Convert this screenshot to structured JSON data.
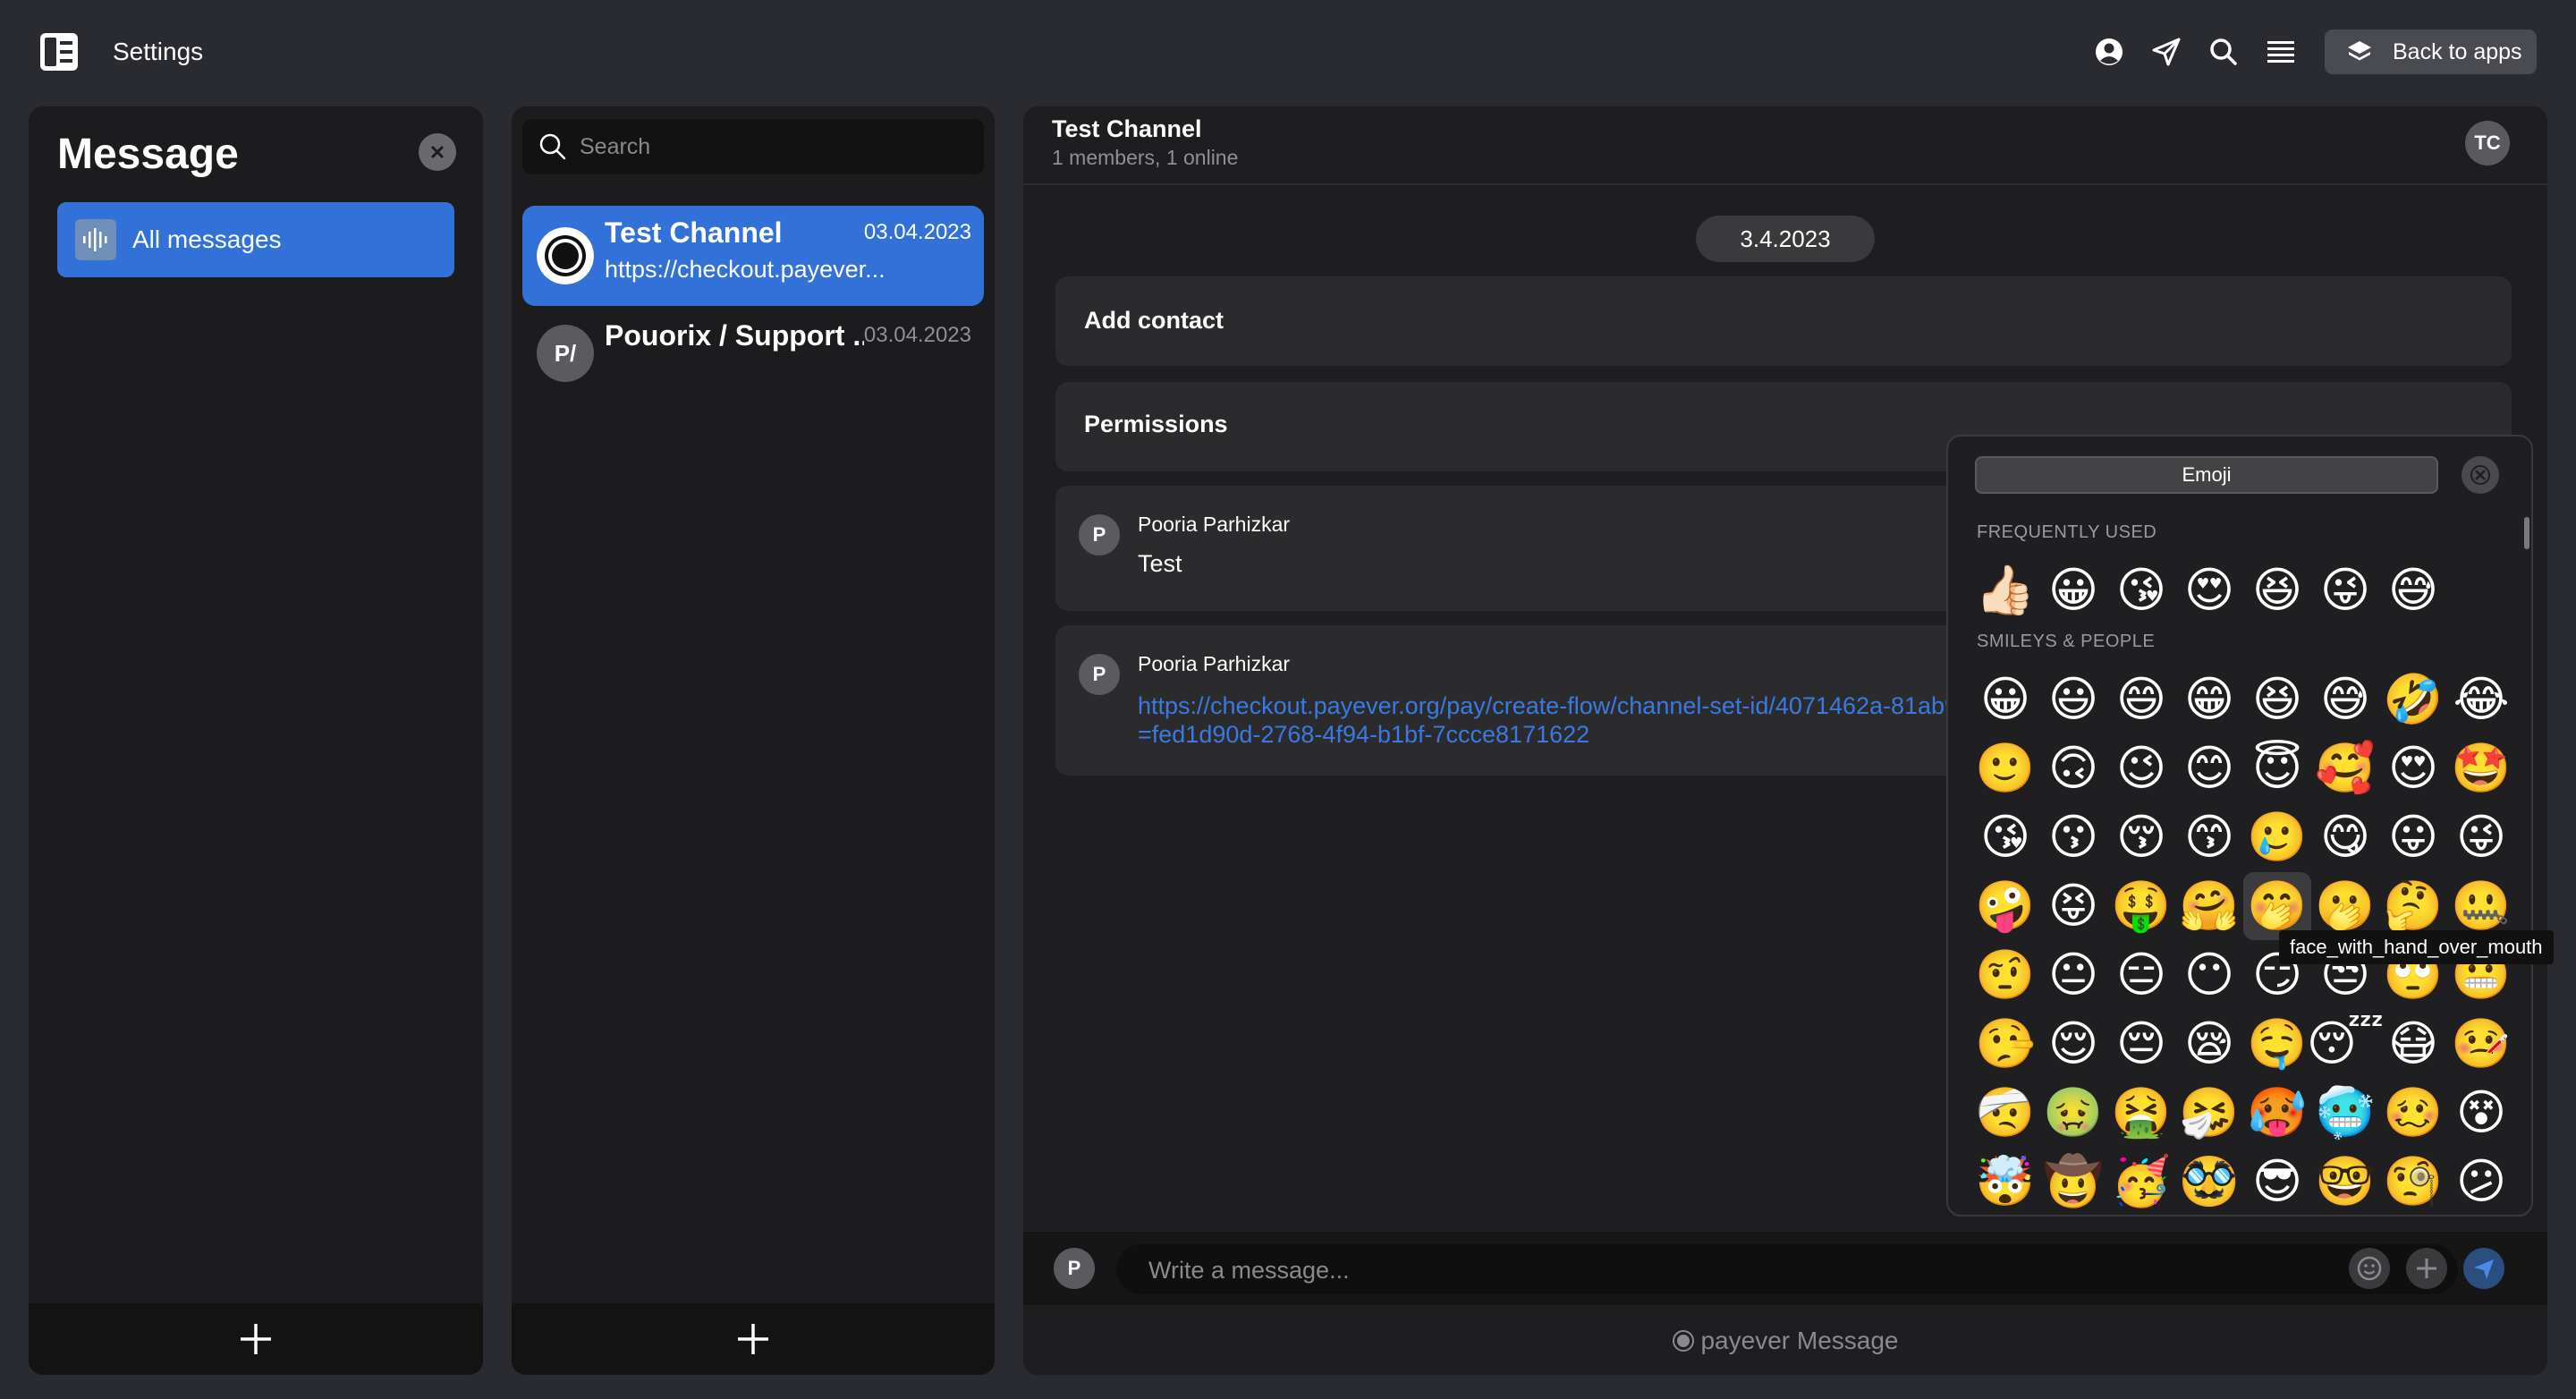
{
  "topbar": {
    "title": "Settings",
    "back_label": "Back to apps",
    "icons": [
      "sidebar-toggle-icon",
      "profile-icon",
      "send-icon",
      "search-icon",
      "menu-icon"
    ]
  },
  "left_panel": {
    "title": "Message",
    "all_messages_label": "All messages",
    "accent_color": "#3271d7"
  },
  "mid_panel": {
    "search_placeholder": "Search",
    "chats": [
      {
        "name": "Test Channel",
        "date": "03.04.2023",
        "preview": "https://checkout.payever...",
        "avatar": ""
      },
      {
        "name": "Pouorix / Support ...",
        "date": "03.04.2023",
        "preview": "",
        "avatar": "P/"
      }
    ]
  },
  "channel": {
    "name": "Test Channel",
    "subtitle": "1 members, 1 online",
    "badge": "TC",
    "date_divider": "3.4.2023",
    "add_contact_label": "Add contact",
    "permissions_label": "Permissions",
    "messages": [
      {
        "author": "Pooria Parhizkar",
        "avatar": "P",
        "text": "Test"
      },
      {
        "author": "Pooria Parhizkar",
        "avatar": "P",
        "link": "https://checkout.payever.org/pay/create-flow/channel-set-id/4071462a-81ab92?cart=fed1d90d-2768-4f94-b1bf-7ccce8171622"
      }
    ],
    "composer_placeholder": "Write a message...",
    "composer_avatar": "P",
    "brand_text": "payever Message"
  },
  "emoji_picker": {
    "tab_label": "Emoji",
    "frequently_used_label": "FREQUENTLY USED",
    "smileys_label": "SMILEYS & PEOPLE",
    "frequently_used": [
      "👍🏻",
      "😀",
      "😘",
      "😍",
      "😆",
      "😜",
      "😅"
    ],
    "smileys": [
      [
        "😀",
        "😃",
        "😄",
        "😁",
        "😆",
        "😅",
        "🤣",
        "😂"
      ],
      [
        "🙂",
        "🙃",
        "😉",
        "😊",
        "😇",
        "🥰",
        "😍",
        "🤩"
      ],
      [
        "😘",
        "😗",
        "😚",
        "😙",
        "🥲",
        "😋",
        "😛",
        "😜"
      ],
      [
        "🤪",
        "😝",
        "🤑",
        "🤗",
        "🤭",
        "🫢",
        "🤔",
        "🤐"
      ],
      [
        "🤨",
        "😐",
        "😑",
        "😶",
        "😏",
        "😒",
        "🙄",
        "😬"
      ],
      [
        "🤥",
        "😌",
        "😔",
        "😪",
        "🤤",
        "😴",
        "😷",
        "🤒"
      ],
      [
        "🤕",
        "🤢",
        "🤮",
        "🤧",
        "🥵",
        "🥶",
        "🥴",
        "😵"
      ],
      [
        "🤯",
        "🤠",
        "🥳",
        "🥸",
        "😎",
        "🤓",
        "🧐",
        "😕"
      ]
    ],
    "tooltip": "face_with_hand_over_mouth"
  }
}
